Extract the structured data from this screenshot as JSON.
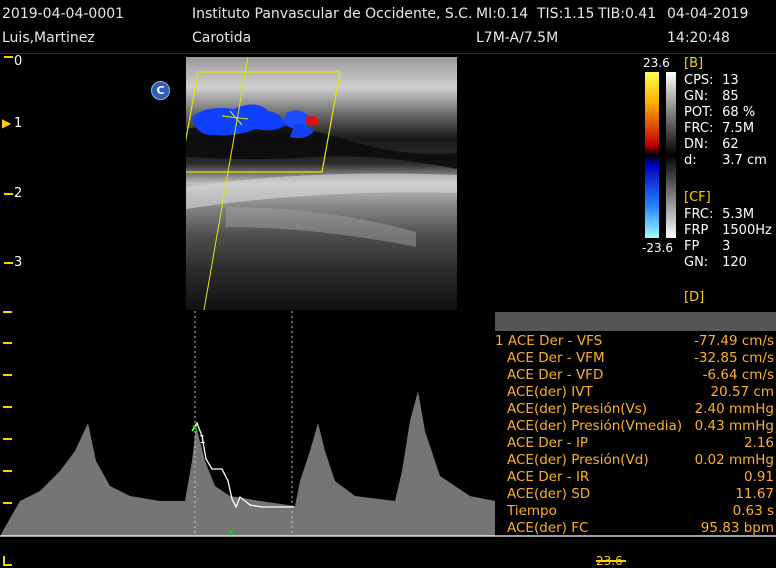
{
  "header": {
    "patient_id": "2019-04-04-0001",
    "institution": "Instituto Panvascular de Occidente, S.C.",
    "mi": "MI:0.14",
    "tis": "TIS:1.15",
    "tib": "TIB:0.41",
    "date": "04-04-2019",
    "patient_name": "Luis,Martinez",
    "exam": "Carotida",
    "probe": "L7M-A/7.5M",
    "time": "14:20:48"
  },
  "depth_scale": [
    "0",
    "1",
    "2",
    "3"
  ],
  "color_badge": "C",
  "color_bar": {
    "max": "23.6",
    "min": "-23.6"
  },
  "b_params": {
    "title": "[B]",
    "rows": [
      {
        "key": "CPS:",
        "value": "13"
      },
      {
        "key": "GN:",
        "value": "85"
      },
      {
        "key": "POT:",
        "value": "68 %"
      },
      {
        "key": "FRC:",
        "value": "7.5M"
      },
      {
        "key": "DN:",
        "value": "62"
      },
      {
        "key": "d:",
        "value": "3.7 cm"
      }
    ]
  },
  "cf_params": {
    "title": "[CF]",
    "rows": [
      {
        "key": "FRC:",
        "value": "5.3M"
      },
      {
        "key": "FRP",
        "value": "1500Hz"
      },
      {
        "key": "FP",
        "value": "3"
      },
      {
        "key": "GN:",
        "value": "120"
      }
    ]
  },
  "d_params": {
    "title": "[D]"
  },
  "measurements": [
    {
      "label": "1 ACE Der - VFS",
      "value": "-77.49 cm/s"
    },
    {
      "label": "ACE Der - VFM",
      "value": "-32.85 cm/s"
    },
    {
      "label": "ACE Der - VFD",
      "value": "-6.64 cm/s"
    },
    {
      "label": "ACE(der) IVT",
      "value": "20.57 cm"
    },
    {
      "label": "ACE(der) Presión(Vs)",
      "value": "2.40 mmHg"
    },
    {
      "label": "ACE(der) Presión(Vmedia)",
      "value": "0.43 mmHg"
    },
    {
      "label": "ACE Der - IP",
      "value": "2.16"
    },
    {
      "label": "ACE(der) Presión(Vd)",
      "value": "0.02 mmHg"
    },
    {
      "label": "ACE Der - IR",
      "value": "0.91"
    },
    {
      "label": "ACE(der) SD",
      "value": "11.67"
    },
    {
      "label": "Tiempo",
      "value": "0.63 s"
    },
    {
      "label": "ACE(der) FC",
      "value": "95.83 bpm"
    }
  ],
  "doppler": {
    "cursor_label": "1",
    "scale_value": "23.6"
  },
  "colors": {
    "accent_yellow": "#ffd000",
    "measure_orange": "#ffb020",
    "marker_green": "#00e000",
    "flow_blue": "#1040ff",
    "flow_red": "#e01010"
  }
}
